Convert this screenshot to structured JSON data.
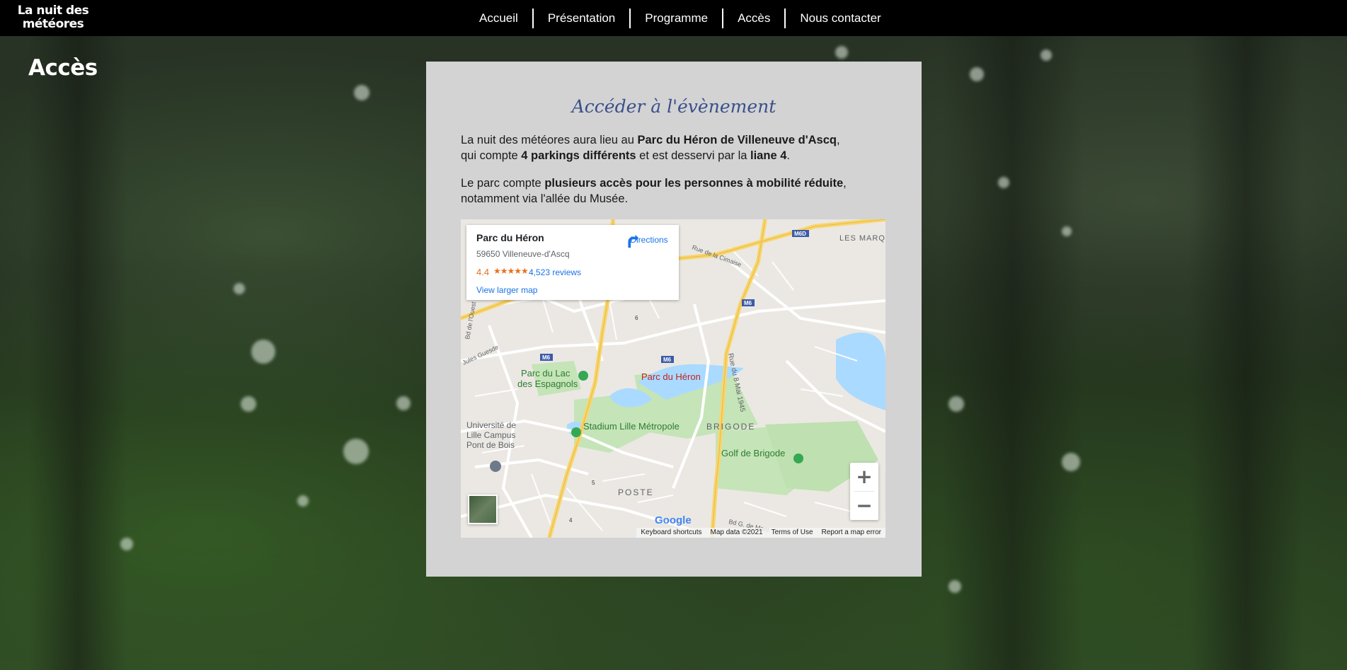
{
  "site": {
    "logo": "La nuit des météores"
  },
  "nav": {
    "items": [
      "Accueil",
      "Présentation",
      "Programme",
      "Accès",
      "Nous contacter"
    ]
  },
  "page": {
    "title": "Accès"
  },
  "section": {
    "heading": "Accéder à l'évènement",
    "para1": {
      "t1": "La nuit des météores aura lieu au ",
      "b1": "Parc du Héron de Villeneuve d'Ascq",
      "t2": ", qui compte ",
      "b2": "4 parkings différents",
      "t3": " et est desservi par la ",
      "b3": "liane 4",
      "t4": "."
    },
    "para2": {
      "t1": "Le parc compte ",
      "b1": "plusieurs accès pour les personnes à mobilité réduite",
      "t2": ", notamment via l'allée du Musée."
    }
  },
  "map": {
    "place_name": "Parc du Héron",
    "address": "59650 Villeneuve-d'Ascq",
    "rating": "4.4",
    "stars": "★★★★★",
    "reviews": "4,523 reviews",
    "larger_map": "View larger map",
    "directions": "Directions",
    "zoom_in": "+",
    "zoom_out": "−",
    "footer": [
      "Keyboard shortcuts",
      "Map data ©2021",
      "Terms of Use",
      "Report a map error"
    ],
    "google": "Google",
    "labels": {
      "lac": "Parc du Lac\ndes Espagnols",
      "heron": "Parc du Héron",
      "stadium": "Stadium Lille Métropole",
      "brigode": "BRIGODE",
      "golf": "Golf de Brigode",
      "universite": "Université de\nLille Campus\nPont de Bois",
      "poste": "POSTE",
      "les_marq": "LES MARQ",
      "rue_8mai": "Rue du 8 Mai 1945",
      "rue_cimaise": "Rue de la Cimaise",
      "jules_guesde": "Jules Guesde",
      "bd_ouest": "Bd de l'Ouest",
      "bd_monte": "Bd G. de Mont",
      "m6": "M6",
      "m6d": "M6D",
      "n4": "4",
      "n5": "5",
      "n6": "6"
    }
  },
  "colors": {
    "heading": "#3a4f8c",
    "card": "#d3d3d3",
    "link": "#1a73e8",
    "rating": "#e7711b"
  }
}
